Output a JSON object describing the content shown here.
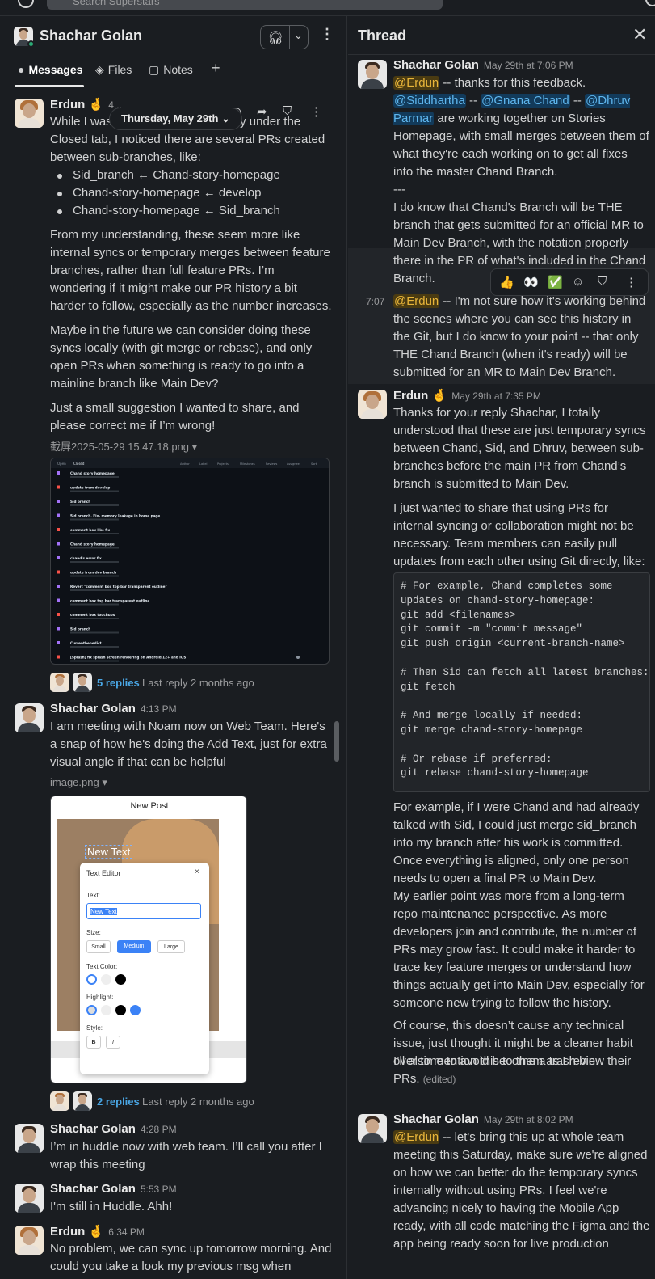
{
  "search": {
    "placeholder": "Search Superstars"
  },
  "channel": {
    "name": "Shachar Golan",
    "tabs": [
      {
        "label": "Messages"
      },
      {
        "label": "Files"
      },
      {
        "label": "Notes"
      }
    ],
    "add_tab": "+",
    "date_divider": "Thursday, May 29th"
  },
  "messages": [
    {
      "author": "Erdun",
      "emoji": "🤞",
      "time": "4...",
      "paragraphs": [
        "While I was reviewing the PR history under the Closed tab, I noticed there are several PRs created between sub-branches, like:"
      ],
      "bullets": [
        "Sid_branch ← Chand-story-homepage",
        "Chand-story-homepage ← develop",
        "Chand-story-homepage ← Sid_branch"
      ],
      "paragraphs2": [
        "From my understanding, these seem more like internal syncs or temporary merges between feature branches, rather than full feature PRs. I’m wondering if it might make our PR history a bit harder to follow, especially as the number increases.",
        "Maybe in the future we can consider doing these syncs locally (with git merge or rebase), and only open PRs when something is ready to go into a mainline branch like Main Dev?",
        "Just a small suggestion I wanted to share, and please correct me if I’m wrong!"
      ],
      "file": "截屏2025-05-29 15.47.18.png",
      "replies": {
        "count": "5 replies",
        "last": "Last reply 2 months ago"
      }
    },
    {
      "author": "Shachar Golan",
      "time": "4:13 PM",
      "text": "I am meeting with Noam now on Web Team. Here's a snap of how he's doing the Add Text, just for extra visual angle if that can be helpful",
      "file": "image.png",
      "replies": {
        "count": "2 replies",
        "last": "Last reply 2 months ago"
      }
    },
    {
      "author": "Shachar Golan",
      "time": "4:28 PM",
      "text": "I’m in huddle now with web team. I’ll call you after I wrap this meeting"
    },
    {
      "author": "Shachar Golan",
      "time": "5:53 PM",
      "text": "I'm still in Huddle. Ahh!"
    },
    {
      "author": "Erdun",
      "emoji": "🤞",
      "time": "6:34 PM",
      "text": "No problem, we can sync up tomorrow morning. And could you take a look my previous msg when"
    }
  ],
  "pr_list": {
    "header": [
      "Open",
      "Closed",
      "Author",
      "Label",
      "Projects",
      "Milestones",
      "Reviews",
      "Assignee",
      "Sort"
    ],
    "rows": [
      "Chand story homepage",
      "update from develop",
      "Sid branch",
      "Sid branch. Fix- memory leakage in home page",
      "comment box like fix",
      "Chand story homepage",
      "chand's error fix",
      "update from dev branch",
      "Revert \"comment box top bar transparent outline\"",
      "comment box top bar transparent outline",
      "comment box touchups",
      "Sid branch",
      "Currentbenedict",
      "[Splash] fix splash screen rendering on Android 12+ and iOS"
    ]
  },
  "editor": {
    "title": "New Post",
    "canvas_text": "New Text",
    "dialog_title": "Text Editor",
    "close": "×",
    "text_label": "Text:",
    "text_value": "New Text",
    "size_label": "Size:",
    "sizes": [
      "Small",
      "Medium",
      "Large"
    ],
    "color_label": "Text Color:",
    "highlight_label": "Highlight:",
    "style_label": "Style:",
    "bold": "B",
    "italic": "I",
    "colors": {
      "accent": "#3b82f6",
      "black": "#000000",
      "white": "#ffffff"
    }
  },
  "thread": {
    "title": "Thread",
    "messages": [
      {
        "author": "Shachar Golan",
        "time": "May 29th at 7:06 PM",
        "mention": "@Erdun",
        "text1": " -- thanks for this feedback.",
        "links": [
          "@Siddhartha",
          "@Gnana Chand",
          "@Dhruv Parmar"
        ],
        "text2": " are working together on Stories Homepage, with small merges between them of what they're each working on to get all fixes into the master Chand Branch.",
        "sep": "---",
        "text3": "I do know that Chand's Branch will be THE branch that gets submitted for an official MR to Main Dev Branch, with the notation properly there in the PR of what's included in the Chand Branch."
      },
      {
        "time": "7:07",
        "mention": "@Erdun",
        "text": " -- I'm not sure how it's working behind the scenes where you can see this history in the Git, but I do know to your point -- that only THE Chand Branch (when it's ready) will be submitted for an MR to Main Dev Branch."
      },
      {
        "author": "Erdun",
        "emoji": "🤞",
        "time": "May 29th at 7:35 PM",
        "p1": "Thanks for your reply Shachar, I totally understood that these are just temporary syncs between Chand, Sid, and Dhruv, between sub-branches before the main PR from Chand’s branch is submitted to Main Dev.",
        "p2": "I just wanted to share that using PRs for internal syncing or collaboration might not be necessary. Team members can easily pull updates from each other using Git directly, like:",
        "code": "# For example, Chand completes some\nupdates on chand-story-homepage:\ngit add <filenames>\ngit commit -m \"commit message\"\ngit push origin <current-branch-name>\n\n# Then Sid can fetch all latest branches:\ngit fetch\n\n# And merge locally if needed:\ngit merge chand-story-homepage\n\n# Or rebase if preferred:\ngit rebase chand-story-homepage",
        "p3": "For example, if I were Chand and had already talked with Sid, I could just merge sid_branch into my branch after his work is committed. Once everything is aligned, only one person needs to open a final PR to Main Dev.",
        "p4": "My earlier point was more from a long-term repo maintenance perspective. As more developers join and contribute, the number of PRs may grow fast. It could make it harder to trace key feature merges or understand how things actually get into Main Dev, especially for someone new trying to follow the history.",
        "p5": "Of course, this doesn’t cause any technical issue, just thought it might be a cleaner habit over time to avoid become a trash bin.",
        "p6": "I’ll also mention this to them as I review their PRs.",
        "edited": "(edited)"
      },
      {
        "author": "Shachar Golan",
        "time": "May 29th at 8:02 PM",
        "mention": "@Erdun",
        "text": " -- let's bring this up at whole team meeting this Saturday, make sure we're aligned on how we can better do the temporary syncs internally without using PRs. I feel we're advancing nicely to having the Mobile App ready, with all code matching the Figma and the app being ready soon for live production"
      }
    ],
    "reactions": [
      "👍",
      "👀",
      "✅"
    ]
  }
}
